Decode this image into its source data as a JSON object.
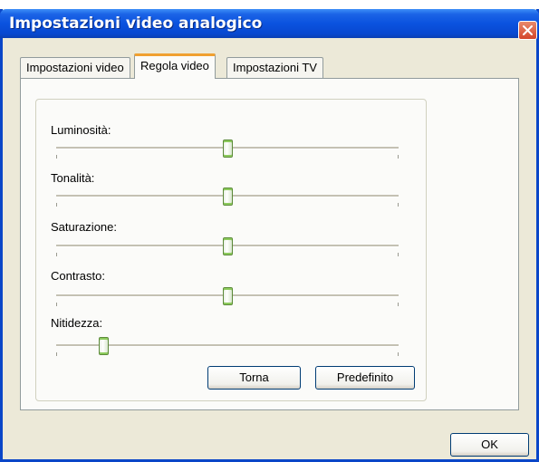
{
  "window": {
    "title": "Impostazioni video analogico",
    "close_icon": "close-icon"
  },
  "tabs": [
    {
      "label": "Impostazioni video",
      "active": false
    },
    {
      "label": "Regola video",
      "active": true
    },
    {
      "label": "Impostazioni TV",
      "active": false
    }
  ],
  "sliders": [
    {
      "label": "Luminosità:",
      "value_fraction": 0.5
    },
    {
      "label": "Tonalità:",
      "value_fraction": 0.5
    },
    {
      "label": "Saturazione:",
      "value_fraction": 0.5
    },
    {
      "label": "Contrasto:",
      "value_fraction": 0.5
    },
    {
      "label": "Nitidezza:",
      "value_fraction": 0.14
    }
  ],
  "buttons": {
    "reset_label": "Torna",
    "default_label": "Predefinito",
    "ok_label": "OK"
  },
  "colors": {
    "titlebar": "#0a52df",
    "dialog_background": "#ece9d8",
    "active_tab_accent": "#f0a030",
    "close_button": "#d4452a"
  }
}
